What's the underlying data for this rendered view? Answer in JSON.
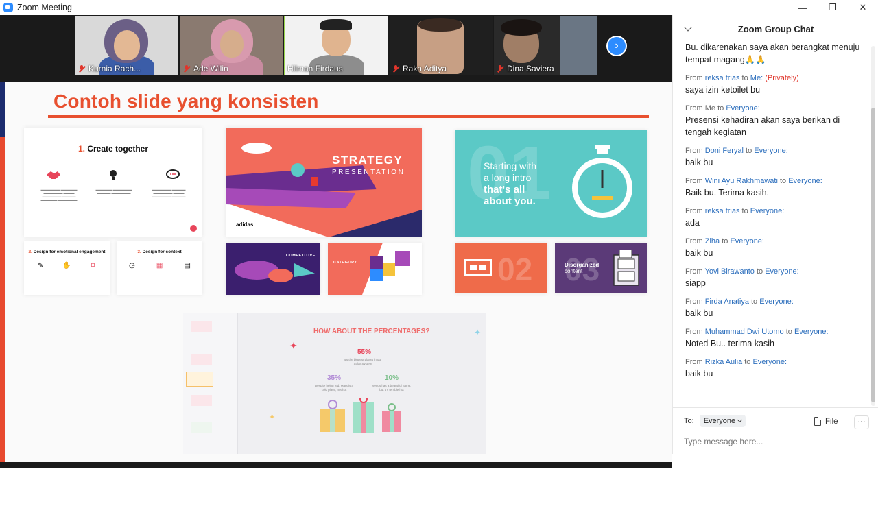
{
  "window": {
    "title": "Zoom Meeting",
    "controls": {
      "minimize": "—",
      "restore": "❐",
      "close": "✕"
    }
  },
  "participants": [
    {
      "name": "Kurnia Rach...",
      "muted": true,
      "active": false
    },
    {
      "name": "Ade Wilin",
      "muted": true,
      "active": false
    },
    {
      "name": "Hilman Firdaus",
      "muted": false,
      "active": true
    },
    {
      "name": "Raka Aditya",
      "muted": true,
      "active": false
    },
    {
      "name": "Dina Saviera",
      "muted": true,
      "active": false
    }
  ],
  "gallery_next_icon": "›",
  "shared_screen": {
    "slide_title": "Contoh slide yang konsisten",
    "cards": {
      "create_together": {
        "number": "1.",
        "title": "Create together"
      },
      "emotional": {
        "number": "2.",
        "title": "Design for emotional engagement"
      },
      "context": {
        "number": "3.",
        "title": "Design for context"
      },
      "strategy": {
        "line1": "STRATEGY",
        "line2": "PRESENTATION",
        "brand": "adidas"
      },
      "competitive": {
        "label": "COMPETITIVE"
      },
      "category": {
        "label": "CATEGORY"
      },
      "intro": {
        "line1": "Starting with",
        "line2": "a long intro",
        "line3": "that's all",
        "line4": "about you.",
        "bg_num": "01"
      },
      "facts": {
        "bg_num": "02"
      },
      "disorganized": {
        "line1": "Disorganized",
        "line2": "content",
        "bg_num": "03"
      },
      "percentages": {
        "title": "HOW ABOUT THE PERCENTAGES?",
        "p1": "55%",
        "p2": "35%",
        "p3": "10%",
        "d1": "It's the biggest planet in our Solar System",
        "d2": "Despite being red, Mars is a cold place, not hot",
        "d3": "Venus has a beautiful name, but it's terrible hot"
      }
    }
  },
  "chat": {
    "header": "Zoom Group Chat",
    "first_text": "Bu. dikarenakan saya akan berangkat menuju tempat magang🙏🙏",
    "messages": [
      {
        "from_label": "From",
        "sender": "reksa trias",
        "to_label": "to",
        "recipient": "Me:",
        "private": "(Privately)",
        "text": "saya izin ketoilet bu"
      },
      {
        "from_label": "From",
        "sender": "Me",
        "to_label": "to",
        "recipient": "Everyone:",
        "private": "",
        "text": "Presensi kehadiran akan saya berikan di tengah kegiatan"
      },
      {
        "from_label": "From",
        "sender": "Doni Feryal",
        "to_label": "to",
        "recipient": "Everyone:",
        "private": "",
        "text": "baik bu"
      },
      {
        "from_label": "From",
        "sender": "Wini Ayu Rakhmawati",
        "to_label": "to",
        "recipient": "Everyone:",
        "private": "",
        "text": "Baik bu. Terima kasih."
      },
      {
        "from_label": "From",
        "sender": "reksa trias",
        "to_label": "to",
        "recipient": "Everyone:",
        "private": "",
        "text": "ada"
      },
      {
        "from_label": "From",
        "sender": "Ziha",
        "to_label": "to",
        "recipient": "Everyone:",
        "private": "",
        "text": "baik bu"
      },
      {
        "from_label": "From",
        "sender": "Yovi Birawanto",
        "to_label": "to",
        "recipient": "Everyone:",
        "private": "",
        "text": "siapp"
      },
      {
        "from_label": "From",
        "sender": "Firda Anatiya",
        "to_label": "to",
        "recipient": "Everyone:",
        "private": "",
        "text": "baik bu"
      },
      {
        "from_label": "From",
        "sender": "Muhammad Dwi Utomo",
        "to_label": "to",
        "recipient": "Everyone:",
        "private": "",
        "text": "Noted Bu.. terima kasih"
      },
      {
        "from_label": "From",
        "sender": "Rizka Aulia",
        "to_label": "to",
        "recipient": "Everyone:",
        "private": "",
        "text": "baik bu"
      }
    ],
    "to_label": "To:",
    "to_value": "Everyone",
    "file_label": "File",
    "more_label": "···",
    "input_placeholder": "Type message here..."
  },
  "colors": {
    "accent_blue": "#2d8cff",
    "slide_orange": "#e8502f",
    "muted_red": "#e0352b",
    "active_speaker": "#9bd64e"
  }
}
